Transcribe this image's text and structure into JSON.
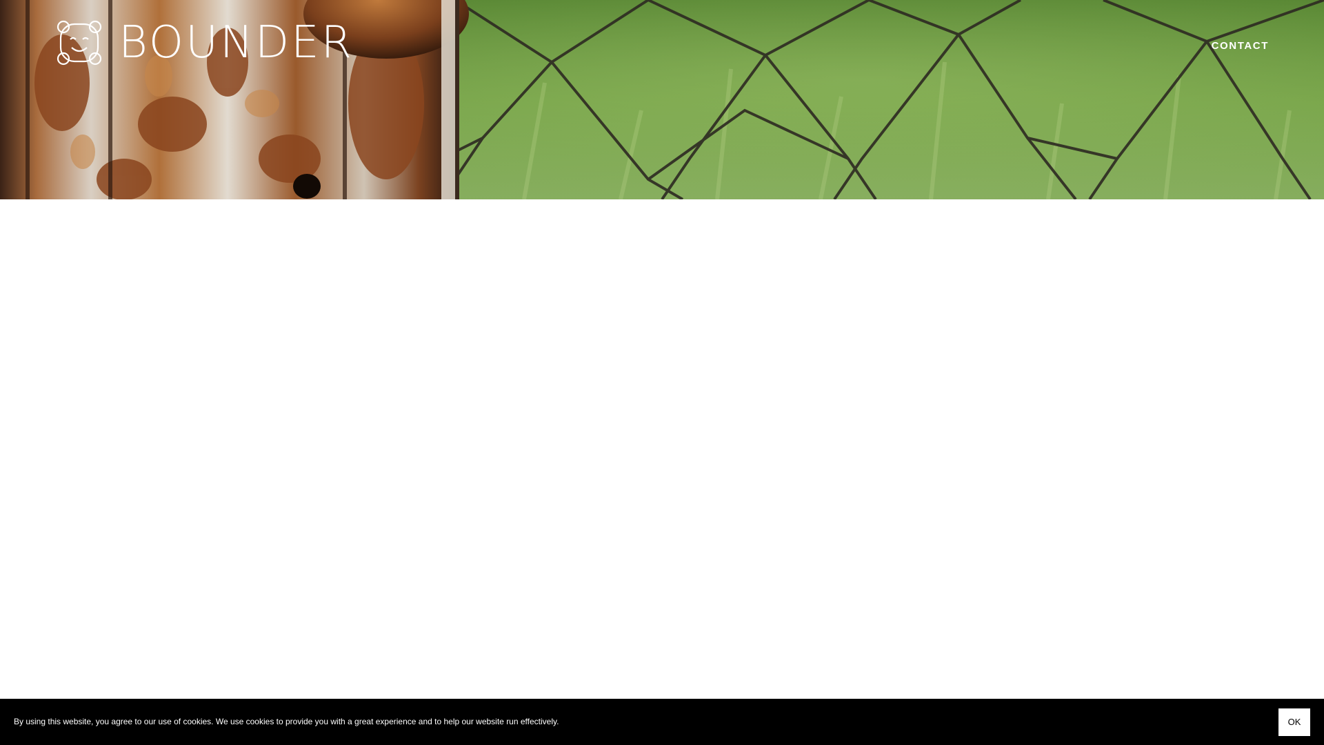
{
  "header": {
    "logo_text": "BOUNDER",
    "logo_icon": "smiling-face-knot-icon",
    "nav": {
      "contact_label": "CONTACT"
    }
  },
  "hero": {
    "image": "rusty-fence-post-chain-link-grass"
  },
  "cookie_bar": {
    "message": "By using this website, you agree to our use of cookies. We use cookies to provide you with a great experience and to help our website run effectively.",
    "ok_label": "OK"
  },
  "colors": {
    "hero_grass": "#6b9a3f",
    "rust": "#8b4a24",
    "cookie_bar_bg": "#000000",
    "text_on_dark": "#ffffff"
  }
}
